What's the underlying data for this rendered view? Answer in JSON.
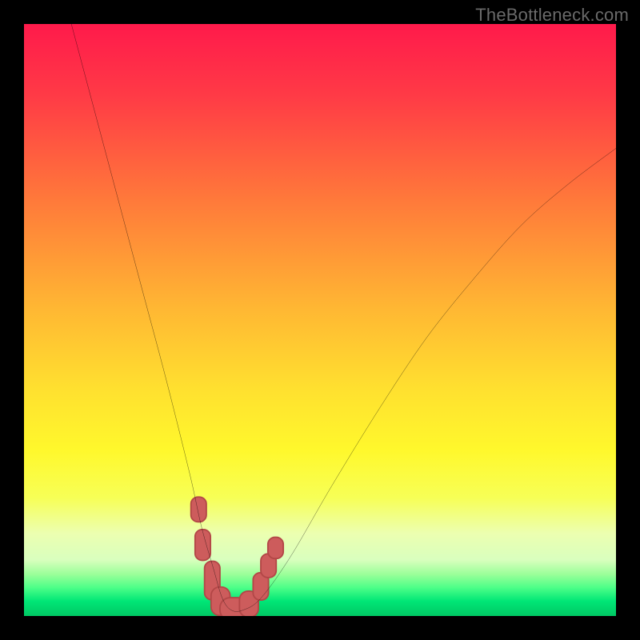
{
  "watermark": "TheBottleneck.com",
  "chart_data": {
    "type": "line",
    "title": "",
    "xlabel": "",
    "ylabel": "",
    "xlim": [
      0,
      100
    ],
    "ylim": [
      0,
      100
    ],
    "grid": false,
    "legend": null,
    "background_gradient_stops": [
      {
        "offset": 0.0,
        "color": "#ff1a4b"
      },
      {
        "offset": 0.12,
        "color": "#ff3a46"
      },
      {
        "offset": 0.3,
        "color": "#ff7a3a"
      },
      {
        "offset": 0.48,
        "color": "#ffb733"
      },
      {
        "offset": 0.62,
        "color": "#ffe12f"
      },
      {
        "offset": 0.72,
        "color": "#fff82c"
      },
      {
        "offset": 0.8,
        "color": "#f7ff56"
      },
      {
        "offset": 0.86,
        "color": "#ecffb0"
      },
      {
        "offset": 0.905,
        "color": "#d9ffbe"
      },
      {
        "offset": 0.93,
        "color": "#99ff99"
      },
      {
        "offset": 0.952,
        "color": "#4dff88"
      },
      {
        "offset": 0.975,
        "color": "#00e676"
      },
      {
        "offset": 1.0,
        "color": "#00c864"
      }
    ],
    "series": [
      {
        "name": "bottleneck-curve",
        "stroke": "#000000",
        "stroke_width": 2.2,
        "x": [
          8,
          12,
          16,
          20,
          24,
          28,
          30,
          32,
          33.5,
          35,
          37,
          40,
          45,
          52,
          60,
          68,
          76,
          84,
          92,
          100
        ],
        "values": [
          100,
          85,
          70,
          55,
          40,
          24,
          15,
          8,
          3,
          1,
          1,
          3,
          10,
          22,
          35,
          47,
          57,
          66,
          73,
          79
        ]
      }
    ],
    "markers": {
      "shape": "rounded-rect",
      "fill": "#cd5c5c",
      "stroke": "#b34747",
      "points": [
        {
          "x": 29.5,
          "y": 18,
          "w": 2.6,
          "h": 4.2
        },
        {
          "x": 30.2,
          "y": 12,
          "w": 2.6,
          "h": 5.2
        },
        {
          "x": 31.8,
          "y": 6,
          "w": 2.6,
          "h": 6.5
        },
        {
          "x": 33.2,
          "y": 2.5,
          "w": 3.2,
          "h": 4.8
        },
        {
          "x": 35.5,
          "y": 1.2,
          "w": 4.8,
          "h": 3.8
        },
        {
          "x": 38.0,
          "y": 2.0,
          "w": 3.2,
          "h": 4.4
        },
        {
          "x": 40.0,
          "y": 5.0,
          "w": 2.6,
          "h": 4.6
        },
        {
          "x": 41.3,
          "y": 8.5,
          "w": 2.6,
          "h": 4.0
        },
        {
          "x": 42.5,
          "y": 11.5,
          "w": 2.6,
          "h": 3.6
        }
      ]
    }
  }
}
